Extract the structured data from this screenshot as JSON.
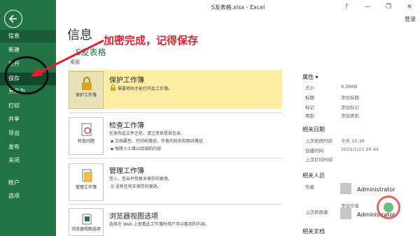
{
  "window": {
    "title": "S友表格.xlsx - Excel",
    "signin": "登录",
    "controls": {
      "help": "?",
      "minimize": "—",
      "restore": "❐",
      "close": "✕"
    }
  },
  "sidebar": {
    "items": [
      {
        "label": "信息"
      },
      {
        "label": "新建"
      },
      {
        "label": "打开"
      },
      {
        "label": "保存"
      },
      {
        "label": "另存为"
      },
      {
        "label": "打印"
      },
      {
        "label": "共享"
      },
      {
        "label": "导出"
      },
      {
        "label": "发布"
      },
      {
        "label": "关闭"
      },
      {
        "label": "帐户"
      },
      {
        "label": "选项"
      }
    ]
  },
  "annotation": {
    "text": "加密完成，记得保存",
    "color": "#e0212f"
  },
  "main": {
    "heading": "信息",
    "filename": "S友表格",
    "filepath": "桌面",
    "protect": {
      "button_label": "保护工作簿",
      "title": "保护工作簿",
      "description": "需要密码才能打开此工作簿。"
    },
    "inspect": {
      "button_label": "检查问题",
      "title": "检查工作簿",
      "description": "在发布此文件之前，请注意其是否包含:",
      "bullets": [
        "文档属性、打印机路径、作者的姓名和相对路径",
        "残障人士难以阅读的内容"
      ]
    },
    "manage": {
      "button_label": "管理工作簿",
      "title": "管理工作簿",
      "description": "签入、签出并恢复未保存的更改。",
      "bullet": "没有任何未保存的更改。"
    },
    "browser": {
      "button_label": "浏览器视图选项",
      "title": "浏览器视图选项",
      "description": "选择在 Web 上查看此工作簿时用户可以看到的内容。"
    }
  },
  "properties": {
    "title": "属性",
    "rows": [
      {
        "label": "大小",
        "value": "9.06KB"
      },
      {
        "label": "标题",
        "value": "添加标题"
      },
      {
        "label": "标记",
        "value": "添加标记"
      },
      {
        "label": "类别",
        "value": "添加类别"
      }
    ],
    "dates_title": "相关日期",
    "dates": [
      {
        "label": "上次修改时间",
        "value": "今天 15:36"
      },
      {
        "label": "创建时间",
        "value": "2021/1/21 20:44"
      },
      {
        "label": "上次打印时间",
        "value": ""
      }
    ],
    "people_title": "相关人员",
    "author_label": "作者",
    "author_name": "Administrator",
    "add_author": "添加作者",
    "last_modified_by_label": "上次修改者",
    "last_modified_by": "Administrator",
    "docs_title": "相关文档"
  },
  "colors": {
    "accent": "#217346",
    "highlight": "#fdeea4"
  }
}
